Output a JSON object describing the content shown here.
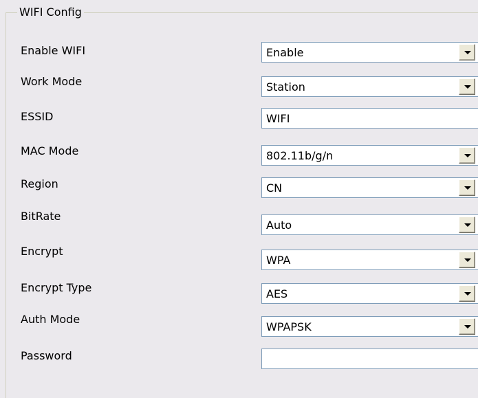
{
  "section": {
    "title": "WIFI Config"
  },
  "rows": [
    {
      "label": "Enable WIFI",
      "type": "select",
      "value": "Enable"
    },
    {
      "label": "Work Mode",
      "type": "select",
      "value": "Station"
    },
    {
      "label": "ESSID",
      "type": "text",
      "value": "WIFI"
    },
    {
      "label": "MAC Mode",
      "type": "select",
      "value": "802.11b/g/n"
    },
    {
      "label": "Region",
      "type": "select",
      "value": "CN"
    },
    {
      "label": "BitRate",
      "type": "select",
      "value": "Auto"
    },
    {
      "label": "Encrypt",
      "type": "select",
      "value": "WPA"
    },
    {
      "label": "Encrypt Type",
      "type": "select",
      "value": "AES"
    },
    {
      "label": "Auth Mode",
      "type": "select",
      "value": "WPAPSK"
    },
    {
      "label": "Password",
      "type": "text",
      "value": ""
    }
  ],
  "icons": {
    "dropdown": "chevron-down-icon"
  },
  "colors": {
    "background": "#ebe9ed",
    "field_border": "#7f9db9",
    "button_face": "#ece9d8"
  }
}
